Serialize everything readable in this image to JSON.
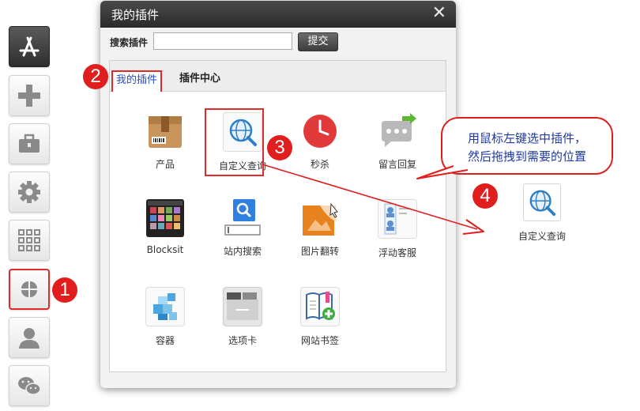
{
  "dialog": {
    "title": "我的插件",
    "close_symbol": "✕",
    "search_label": "搜索插件",
    "search_value": "",
    "search_placeholder": "",
    "submit_label": "提交"
  },
  "tabs": [
    {
      "label": "我的插件",
      "active": true
    },
    {
      "label": "插件中心",
      "active": false
    }
  ],
  "plugins": [
    {
      "label": "产品",
      "icon": "package-icon"
    },
    {
      "label": "自定义查询",
      "icon": "globe-search-icon"
    },
    {
      "label": "秒杀",
      "icon": "clock-icon"
    },
    {
      "label": "留言回复",
      "icon": "message-reply-icon"
    },
    {
      "label": "Blocksit",
      "icon": "photo-grid-icon"
    },
    {
      "label": "站内搜索",
      "icon": "search-icon"
    },
    {
      "label": "图片翻转",
      "icon": "image-flip-icon"
    },
    {
      "label": "浮动客服",
      "icon": "float-service-icon"
    },
    {
      "label": "容器",
      "icon": "container-icon"
    },
    {
      "label": "选项卡",
      "icon": "tabs-icon"
    },
    {
      "label": "网站书签",
      "icon": "bookmark-icon"
    }
  ],
  "sidebar": [
    {
      "icon": "app-store-icon"
    },
    {
      "icon": "plus-icon"
    },
    {
      "icon": "toolbox-icon"
    },
    {
      "icon": "gear-icon"
    },
    {
      "icon": "grid-icon"
    },
    {
      "icon": "plugins-icon"
    },
    {
      "icon": "user-icon"
    },
    {
      "icon": "wechat-icon"
    }
  ],
  "steps": [
    "1",
    "2",
    "3",
    "4"
  ],
  "callout": {
    "line1": "用鼠标左键选中插件，",
    "line2": "然后拖拽到需要的位置"
  },
  "dropped_plugin": {
    "label": "自定义查询",
    "icon": "globe-search-icon"
  },
  "colors": {
    "accent_red": "#e01e1e",
    "callout_text": "#1f3a9e",
    "tab_active_text": "#2a4ec2"
  }
}
